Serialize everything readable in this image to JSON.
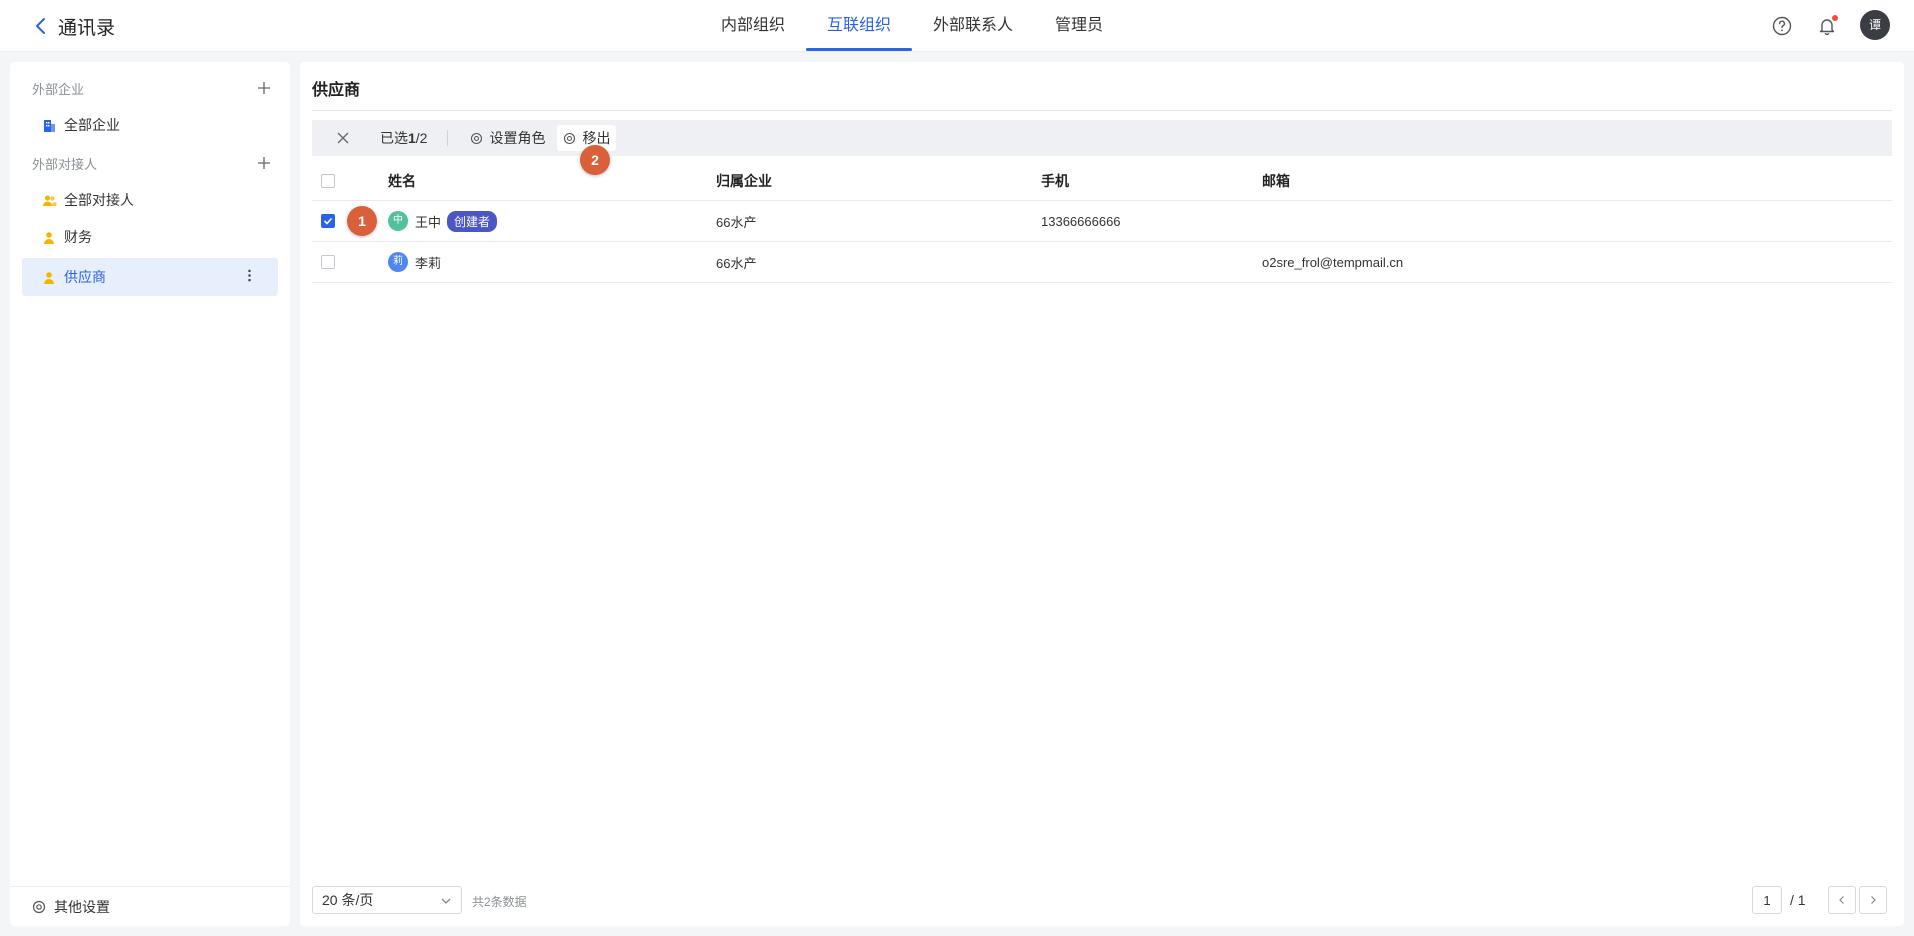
{
  "header": {
    "title": "通讯录",
    "tabs": [
      "内部组织",
      "互联组织",
      "外部联系人",
      "管理员"
    ],
    "active_tab": 1,
    "avatar_text": "谭"
  },
  "sidebar": {
    "section1_label": "外部企业",
    "item_all_companies": "全部企业",
    "section2_label": "外部对接人",
    "item_all_contacts": "全部对接人",
    "item_finance": "财务",
    "item_supplier": "供应商",
    "footer_label": "其他设置"
  },
  "main": {
    "title": "供应商",
    "selection": {
      "prefix": "已选",
      "selected": "1",
      "total": "/2"
    },
    "actions": {
      "set_role": "设置角色",
      "remove": "移出"
    },
    "badges": {
      "one": "1",
      "two": "2"
    },
    "columns": [
      "姓名",
      "归属企业",
      "手机",
      "邮箱"
    ],
    "rows": [
      {
        "avatar": "中",
        "name": "王中",
        "tag": "创建者",
        "company": "66水产",
        "phone": "13366666666",
        "email": "",
        "checked": true,
        "avatar_color": "#52c29a"
      },
      {
        "avatar": "莉",
        "name": "李莉",
        "tag": "",
        "company": "66水产",
        "phone": "",
        "email": "o2sre_frol@tempmail.cn",
        "checked": false,
        "avatar_color": "#4f86f0"
      }
    ],
    "pagination": {
      "page_size": "20 条/页",
      "total": "共2条数据",
      "current_page": "1",
      "page_count": "/ 1"
    }
  },
  "colors": {
    "accent": "#2a62e8",
    "creator_tag": "#4c57c6",
    "step_badge": "#d9603b"
  }
}
